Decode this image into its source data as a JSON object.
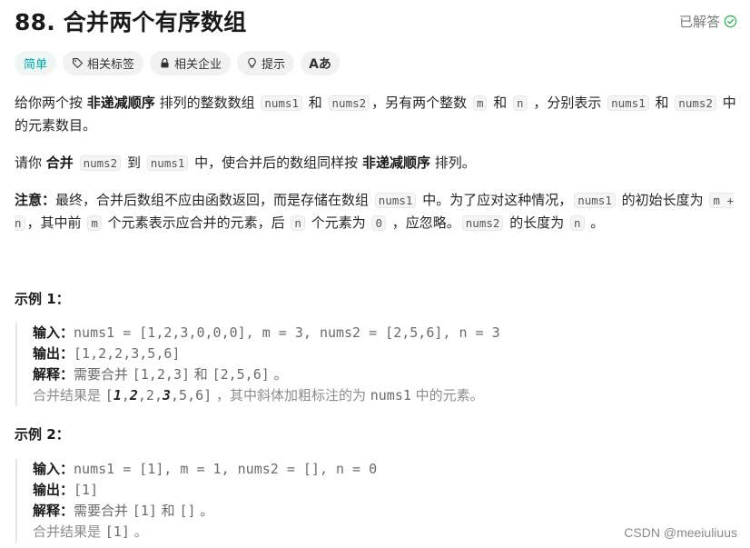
{
  "problem": {
    "title": "88. 合并两个有序数组",
    "status": "已解答"
  },
  "tags": {
    "difficulty": "简单",
    "topics": "相关标签",
    "companies": "相关企业",
    "hints": "提示",
    "lang": "Aあ"
  },
  "icons": {
    "tag": "tag-icon",
    "lock": "lock-icon",
    "bulb": "lightbulb-icon",
    "translate": "translate-icon",
    "check": "check-circle-icon"
  },
  "colors": {
    "difficulty": "#00a8a8",
    "solved_check": "#2db55d"
  },
  "desc1": {
    "t1": "给你两个按 ",
    "b1": "非递减顺序",
    "t2": " 排列的整数数组 ",
    "c1": "nums1",
    "t3": " 和 ",
    "c2": "nums2",
    "t4": "，另有两个整数 ",
    "c3": "m",
    "t5": " 和 ",
    "c4": "n",
    "t6": " ，分别表示 ",
    "c5": "nums1",
    "t7": " 和 ",
    "c6": "nums2",
    "t8": " 中的元素数目。"
  },
  "desc2": {
    "t1": "请你 ",
    "b1": "合并",
    "t2": " ",
    "c1": "nums2",
    "t3": " 到 ",
    "c2": "nums1",
    "t4": " 中，使合并后的数组同样按 ",
    "b2": "非递减顺序",
    "t5": " 排列。"
  },
  "desc3": {
    "b1": "注意：",
    "t1": "最终，合并后数组不应由函数返回，而是存储在数组 ",
    "c1": "nums1",
    "t2": " 中。为了应对这种情况，",
    "c2": "nums1",
    "t3": " 的初始长度为 ",
    "c3": "m + n",
    "t4": "，其中前 ",
    "c4": "m",
    "t5": " 个元素表示应合并的元素，后 ",
    "c5": "n",
    "t6": " 个元素为 ",
    "c6": "0",
    "t7": " ，应忽略。",
    "c7": "nums2",
    "t8": " 的长度为 ",
    "c8": "n",
    "t9": " 。"
  },
  "example1": {
    "title": "示例 1：",
    "input_label": "输入：",
    "input": "nums1 = [1,2,3,0,0,0], m = 3, nums2 = [2,5,6], n = 3",
    "output_label": "输出：",
    "output": "[1,2,2,3,5,6]",
    "explain_label": "解释：",
    "explain_t1": "需要合并 ",
    "explain_c1": "[1,2,3]",
    "explain_t2": " 和 ",
    "explain_c2": "[2,5,6]",
    "explain_t3": " 。",
    "note_t1": "合并结果是 ",
    "note_open": "[",
    "note_b1": "1",
    "note_s1": ",",
    "note_b2": "2",
    "note_s2": ",2,",
    "note_b3": "3",
    "note_s3": ",5,6]",
    "note_t2": " ，其中斜体加粗标注的为 ",
    "note_c1": "nums1",
    "note_t3": " 中的元素。"
  },
  "example2": {
    "title": "示例 2：",
    "input_label": "输入：",
    "input": "nums1 = [1], m = 1, nums2 = [], n = 0",
    "output_label": "输出：",
    "output": "[1]",
    "explain_label": "解释：",
    "explain_t1": "需要合并 ",
    "explain_c1": "[1]",
    "explain_t2": " 和 ",
    "explain_c2": "[]",
    "explain_t3": " 。",
    "note_t1": "合并结果是 ",
    "note_c1": "[1]",
    "note_t2": " 。"
  },
  "watermark": "CSDN @meeiuliuus"
}
